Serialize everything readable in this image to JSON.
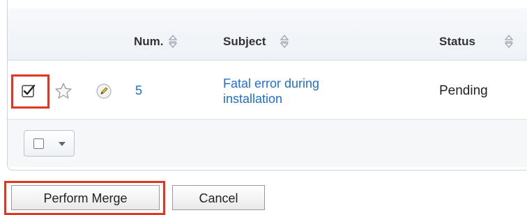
{
  "table": {
    "columns": [
      {
        "label": "Num."
      },
      {
        "label": "Subject"
      },
      {
        "label": "Status"
      }
    ],
    "rows": [
      {
        "num": "5",
        "subject_line1": "Fatal error during",
        "subject_line2": "installation",
        "status": "Pending",
        "checked": true
      }
    ]
  },
  "icons": {
    "sort": "sort-icon",
    "favorite": "star-icon",
    "edit": "pencil-icon",
    "select_all": "checkbox-dropdown"
  },
  "actions": {
    "perform_merge": "Perform Merge",
    "cancel": "Cancel"
  },
  "colors": {
    "highlight": "#e4351f",
    "link": "#1f6fd1",
    "border": "#c9d3dd"
  }
}
